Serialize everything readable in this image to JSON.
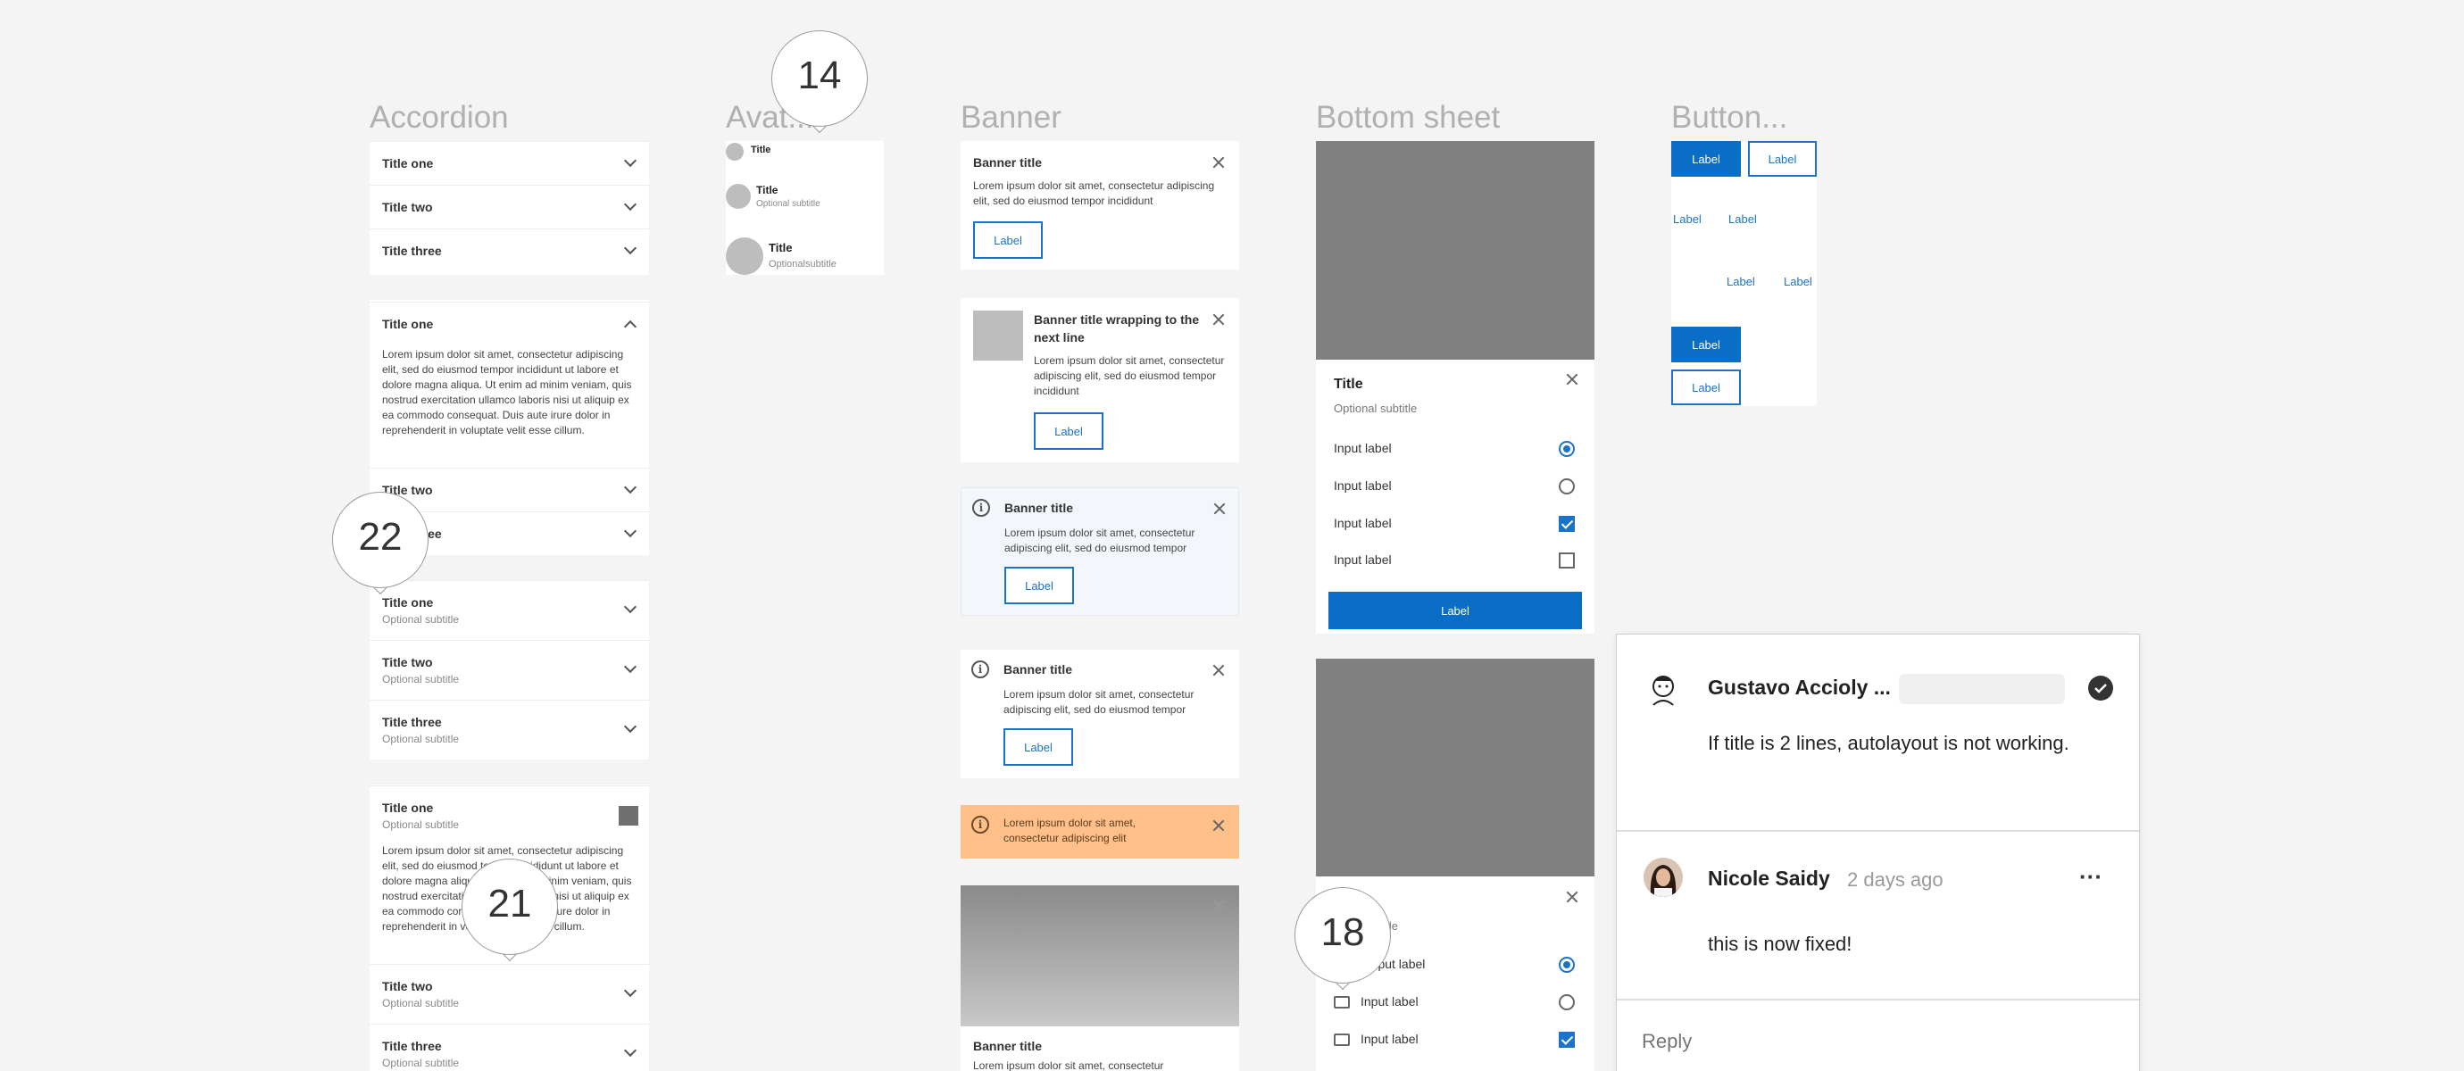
{
  "columns": {
    "accordion": "Accordion",
    "avatar": "Avat...",
    "banner": "Banner",
    "bottom_sheet": "Bottom sheet",
    "button": "Button..."
  },
  "accordion": {
    "group1": [
      "Title one",
      "Title two",
      "Title three"
    ],
    "group2": {
      "expanded_title": "Title one",
      "body": "Lorem ipsum dolor sit amet, consectetur adipiscing elit, sed do eiusmod tempor incididunt ut labore et dolore magna aliqua. Ut enim ad minim veniam, quis nostrud exercitation ullamco laboris nisi ut aliquip ex ea commodo consequat. Duis aute irure dolor in reprehenderit in voluptate velit esse cillum.",
      "rest": [
        "Title two",
        "Title three"
      ]
    },
    "group3": [
      {
        "title": "Title one",
        "subtitle": "Optional subtitle"
      },
      {
        "title": "Title two",
        "subtitle": "Optional subtitle"
      },
      {
        "title": "Title three",
        "subtitle": "Optional subtitle"
      }
    ],
    "group4": {
      "expanded_title": "Title one",
      "expanded_subtitle": "Optional subtitle",
      "body": "Lorem ipsum dolor sit amet, consectetur adipiscing elit, sed do eiusmod tempor incididunt ut labore et dolore magna aliqua. Ut enim ad minim veniam, quis nostrud exercitation ullamco laboris nisi ut aliquip ex ea commodo consequat. Duis aute irure dolor in reprehenderit in voluptate velit esse cillum.",
      "rest": [
        {
          "title": "Title two",
          "subtitle": "Optional subtitle"
        },
        {
          "title": "Title three",
          "subtitle": "Optional subtitle"
        }
      ]
    }
  },
  "avatar": {
    "items": [
      {
        "title": "Title",
        "subtitle": ""
      },
      {
        "title": "Title",
        "subtitle": "Optional subtitle"
      },
      {
        "title": "Title",
        "subtitle": "Optionalsubtitle"
      }
    ]
  },
  "banner": {
    "b1": {
      "title": "Banner title",
      "text": "Lorem ipsum dolor sit amet, consectetur adipiscing elit, sed do eiusmod tempor incididunt",
      "button": "Label"
    },
    "b2": {
      "title": "Banner title wrapping to the next line",
      "text": "Lorem ipsum dolor sit amet, consectetur adipiscing elit, sed do eiusmod tempor incididunt",
      "button": "Label"
    },
    "b3": {
      "title": "Banner title",
      "text": "Lorem ipsum dolor sit amet, consectetur adipiscing elit, sed do eiusmod tempor",
      "button": "Label"
    },
    "b4": {
      "title": "Banner title",
      "text": "Lorem ipsum dolor sit amet, consectetur adipiscing elit, sed do eiusmod tempor",
      "button": "Label"
    },
    "b5": {
      "text": "Lorem ipsum dolor sit amet, consectetur adipiscing elit"
    },
    "b6": {
      "title": "Banner title",
      "text": "Lorem ipsum dolor sit amet, consectetur"
    }
  },
  "bottom_sheet": {
    "title": "Title",
    "subtitle": "Optional subtitle",
    "options": [
      "Input label",
      "Input label",
      "Input label",
      "Input label"
    ],
    "action": "Label",
    "sheet2": {
      "subtitle": "...subtitle",
      "options": [
        "...nput label",
        "Input label",
        "Input label"
      ]
    }
  },
  "buttons": {
    "filled": "Label",
    "outline": "Label",
    "link1": "Label",
    "link2": "Label",
    "link3": "Label",
    "link4": "Label",
    "filled2": "Label",
    "outline2": "Label"
  },
  "pins": {
    "p14": "14",
    "p22": "22",
    "p21": "21",
    "p18": "18"
  },
  "comments": {
    "c1": {
      "author": "Gustavo Accioly ...",
      "text": "If title is 2 lines, autolayout is not working."
    },
    "c2": {
      "author": "Nicole Saidy",
      "time": "2 days ago",
      "more": "···",
      "text": "this is now fixed!"
    },
    "reply_placeholder": "Reply"
  },
  "colors": {
    "accent": "#0a6ec6",
    "warning": "#ffc08a",
    "info_bg": "#f3f7fc"
  }
}
